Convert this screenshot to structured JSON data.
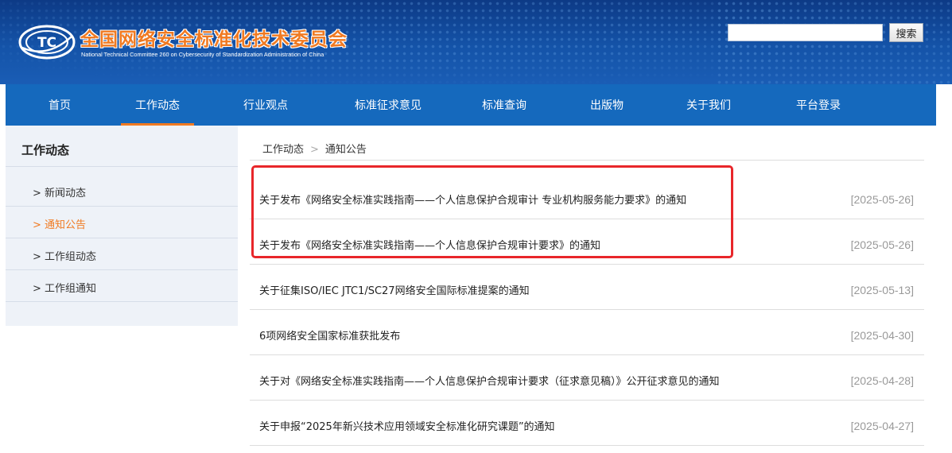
{
  "header": {
    "title": "全国网络安全标准化技术委员会",
    "subtitle": "National Technical Committee 260 on Cybersecurity of Standardization Administration of China",
    "logo_text": "TC",
    "search": {
      "value": "",
      "placeholder": "",
      "button_label": "搜索"
    }
  },
  "nav": {
    "items": [
      {
        "label": "首页"
      },
      {
        "label": "工作动态",
        "active": true
      },
      {
        "label": "行业观点"
      },
      {
        "label": "标准征求意见"
      },
      {
        "label": "标准查询"
      },
      {
        "label": "出版物"
      },
      {
        "label": "关于我们"
      },
      {
        "label": "平台登录"
      }
    ]
  },
  "sidebar": {
    "title": "工作动态",
    "items": [
      {
        "label": "> 新闻动态"
      },
      {
        "label": "> 通知公告",
        "active": true
      },
      {
        "label": "> 工作组动态"
      },
      {
        "label": "> 工作组通知"
      }
    ]
  },
  "breadcrumb": {
    "parent": "工作动态",
    "separator": ">",
    "current": "通知公告"
  },
  "news": {
    "items": [
      {
        "title": "关于发布《网络安全标准实践指南——个人信息保护合规审计 专业机构服务能力要求》的通知",
        "date": "[2025-05-26]",
        "highlighted": true
      },
      {
        "title": "关于发布《网络安全标准实践指南——个人信息保护合规审计要求》的通知",
        "date": "[2025-05-26]",
        "highlighted": true
      },
      {
        "title": "关于征集ISO/IEC JTC1/SC27网络安全国际标准提案的通知",
        "date": "[2025-05-13]"
      },
      {
        "title": "6项网络安全国家标准获批发布",
        "date": "[2025-04-30]"
      },
      {
        "title": "关于对《网络安全标准实践指南——个人信息保护合规审计要求（征求意见稿）》公开征求意见的通知",
        "date": "[2025-04-28]"
      },
      {
        "title": "关于申报“2025年新兴技术应用领域安全标准化研究课题”的通知",
        "date": "[2025-04-27]"
      }
    ]
  },
  "colors": {
    "accent_orange": "#f07a22",
    "nav_blue": "#1569bd",
    "header_blue": "#0d3a86",
    "highlight_red": "#e8262a",
    "date_gray": "#999999"
  }
}
